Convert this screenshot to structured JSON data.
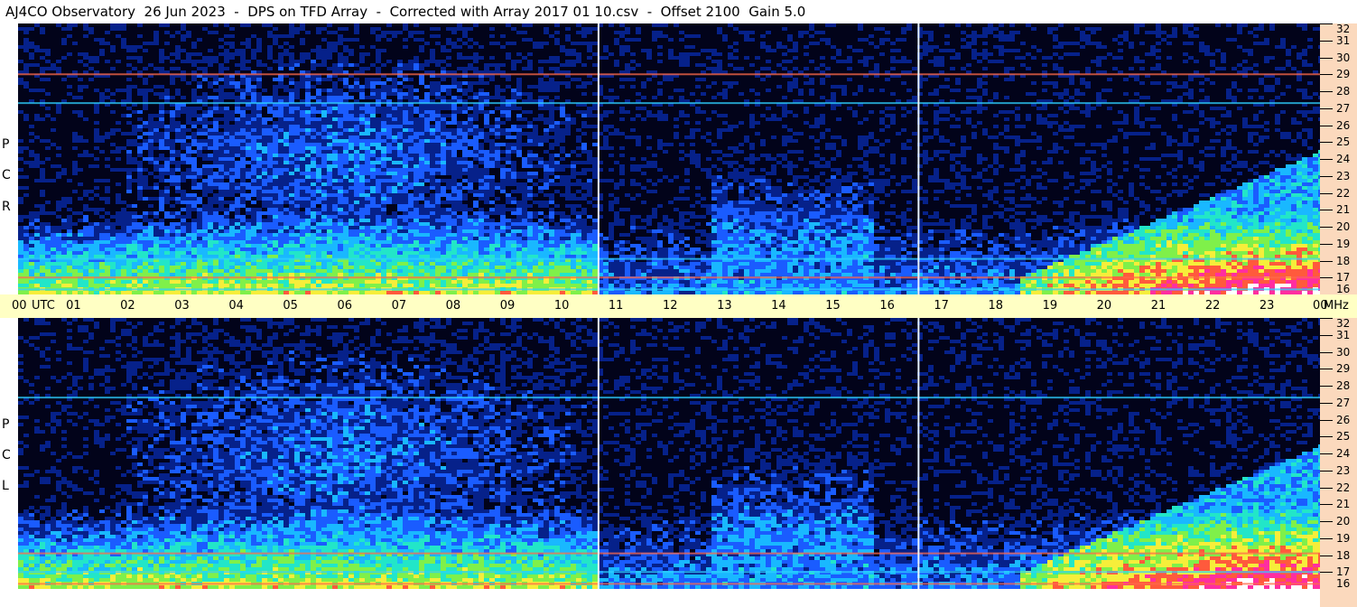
{
  "title": "AJ4CO Observatory  26 Jun 2023  -  DPS on TFD Array  -  Corrected with Array 2017 01 10.csv  -  Offset 2100  Gain 5.0",
  "colors": {
    "background": "#02031a",
    "axis_time_bg": "#ffffc4",
    "axis_freq_bg": "#fbd9bd",
    "palette": [
      "#02031a",
      "#06218a",
      "#1a5cff",
      "#19b8ff",
      "#22e6c8",
      "#7ff04a",
      "#f6ee3a",
      "#ff5a3c",
      "#ff2ea0",
      "#ffffff"
    ]
  },
  "chart_data": [
    {
      "type": "heatmap",
      "polarization": [
        "R",
        "C",
        "P"
      ],
      "x_ticks": [
        "00",
        "UTC",
        "01",
        "02",
        "03",
        "04",
        "05",
        "06",
        "07",
        "08",
        "09",
        "10",
        "11",
        "12",
        "13",
        "14",
        "15",
        "16",
        "17",
        "18",
        "19",
        "20",
        "21",
        "22",
        "23",
        "00",
        "MHz"
      ],
      "x_hours": [
        0,
        1,
        2,
        3,
        4,
        5,
        6,
        7,
        8,
        9,
        10,
        11,
        12,
        13,
        14,
        15,
        16,
        17,
        18,
        19,
        20,
        21,
        22,
        23,
        24
      ],
      "xlim": [
        0,
        24
      ],
      "y_ticks": [
        "32",
        "31",
        "30",
        "29",
        "28",
        "27",
        "26",
        "25",
        "24",
        "23",
        "22",
        "21",
        "20",
        "19",
        "18",
        "17",
        "16"
      ],
      "ylim": [
        16,
        32
      ],
      "markers_utc": [
        10.7,
        16.6
      ],
      "bands_mhz": [
        27.3,
        29.0,
        18.1,
        17.0,
        16.3
      ]
    },
    {
      "type": "heatmap",
      "polarization": [
        "L",
        "C",
        "P"
      ],
      "x_hours": [
        0,
        1,
        2,
        3,
        4,
        5,
        6,
        7,
        8,
        9,
        10,
        11,
        12,
        13,
        14,
        15,
        16,
        17,
        18,
        19,
        20,
        21,
        22,
        23,
        24
      ],
      "xlim": [
        0,
        24
      ],
      "y_ticks": [
        "32",
        "31",
        "30",
        "29",
        "28",
        "27",
        "26",
        "25",
        "24",
        "23",
        "22",
        "21",
        "20",
        "19",
        "18",
        "17",
        "16"
      ],
      "ylim": [
        16,
        32
      ],
      "markers_utc": [
        10.7,
        16.6
      ],
      "bands_mhz": [
        27.3,
        18.1,
        17.0,
        16.3
      ]
    }
  ]
}
